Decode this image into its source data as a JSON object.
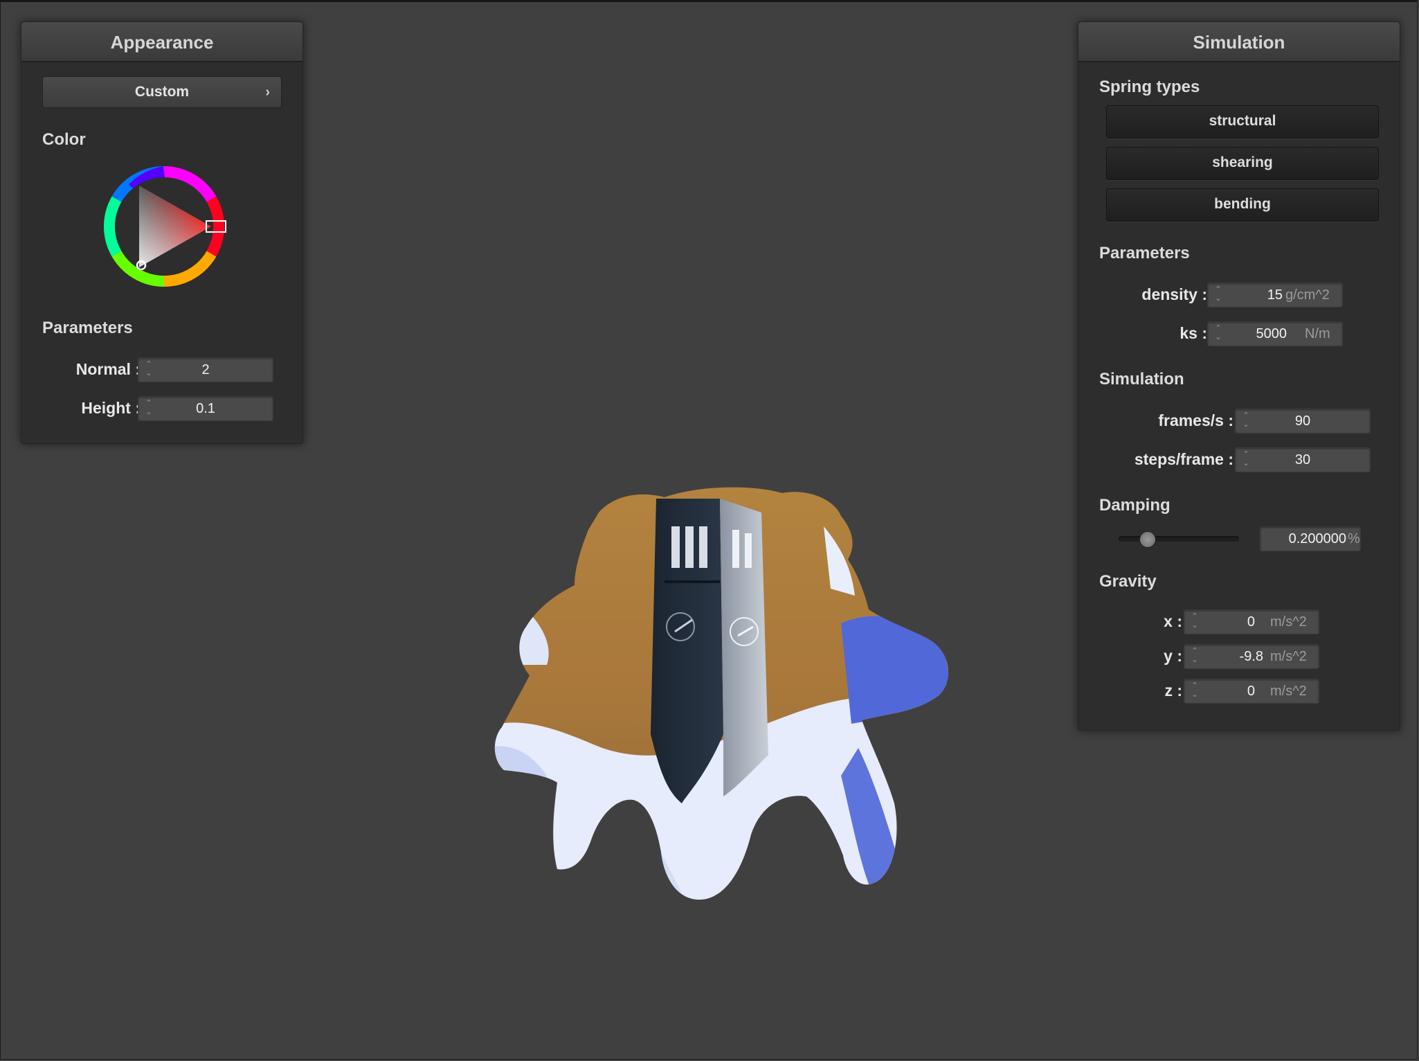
{
  "appearance": {
    "title": "Appearance",
    "preset_label": "Custom",
    "color_section": "Color",
    "parameters_section": "Parameters",
    "normal_label": "Normal :",
    "normal_value": "2",
    "height_label": "Height :",
    "height_value": "0.1",
    "selected_color": "#ff0000"
  },
  "simulation": {
    "title": "Simulation",
    "spring_types_section": "Spring types",
    "spring_types": [
      "structural",
      "shearing",
      "bending"
    ],
    "parameters_section": "Parameters",
    "density_label": "density :",
    "density_value": "15",
    "density_unit": "g/cm^2",
    "ks_label": "ks :",
    "ks_value": "5000",
    "ks_unit": "N/m",
    "simulation_section": "Simulation",
    "fps_label": "frames/s :",
    "fps_value": "90",
    "steps_label": "steps/frame :",
    "steps_value": "30",
    "damping_section": "Damping",
    "damping_value": "0.200000",
    "damping_unit": "%",
    "damping_slider_fraction": 0.2,
    "gravity_section": "Gravity",
    "gx_label": "x :",
    "gx_value": "0",
    "gy_label": "y :",
    "gy_value": "-9.8",
    "gz_label": "z :",
    "gz_value": "0",
    "gravity_unit": "m/s^2"
  }
}
